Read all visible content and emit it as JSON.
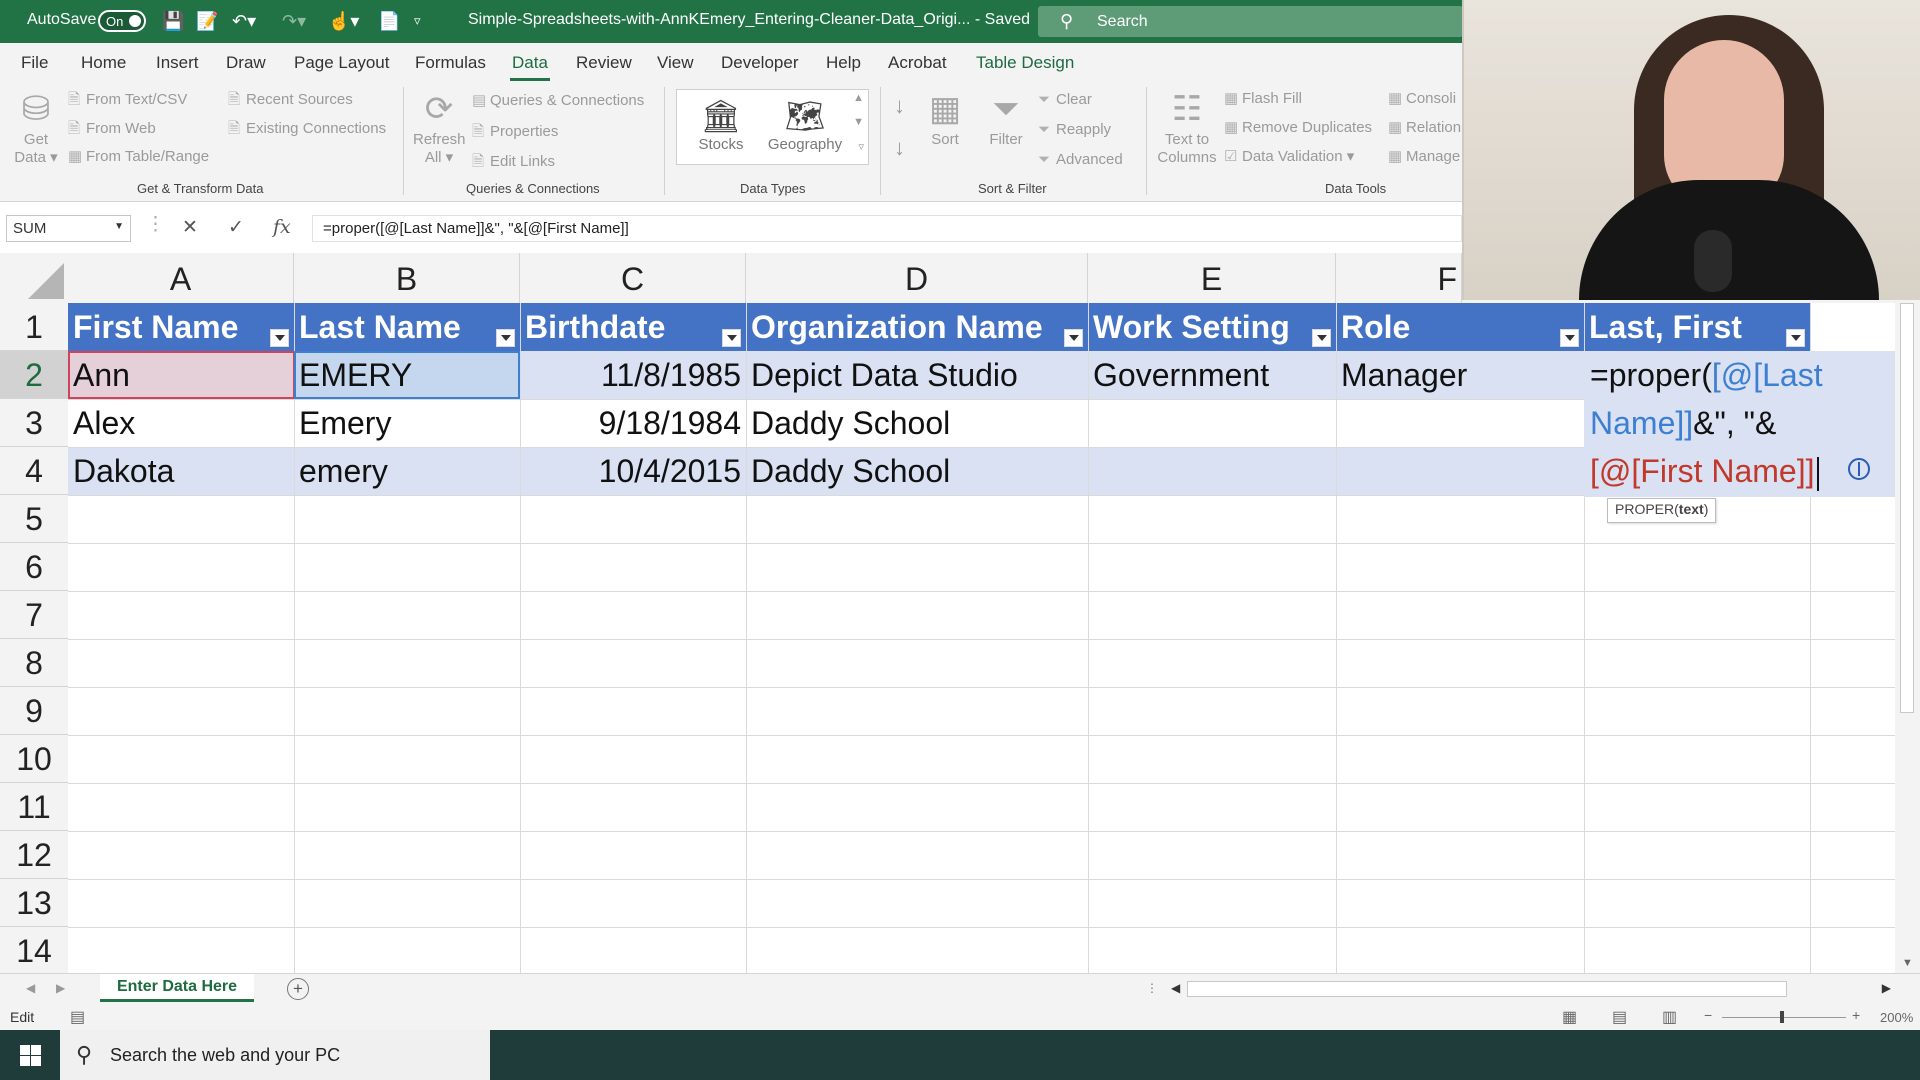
{
  "titlebar": {
    "autosave_label": "AutoSave",
    "autosave_state": "On",
    "document_title": "Simple-Spreadsheets-with-AnnKEmery_Entering-Cleaner-Data_Origi... - Saved",
    "search_placeholder": "Search"
  },
  "ribbon_tabs": [
    "File",
    "Home",
    "Insert",
    "Draw",
    "Page Layout",
    "Formulas",
    "Data",
    "Review",
    "View",
    "Developer",
    "Help",
    "Acrobat",
    "Table Design"
  ],
  "active_tab": "Data",
  "ribbon": {
    "get_data": "Get Data",
    "from_text_csv": "From Text/CSV",
    "from_web": "From Web",
    "from_table_range": "From Table/Range",
    "recent_sources": "Recent Sources",
    "existing_connections": "Existing Connections",
    "group_get_transform": "Get & Transform Data",
    "refresh_all": "Refresh All",
    "queries_connections": "Queries & Connections",
    "properties": "Properties",
    "edit_links": "Edit Links",
    "group_queries": "Queries & Connections",
    "stocks": "Stocks",
    "geography": "Geography",
    "group_data_types": "Data Types",
    "sort": "Sort",
    "filter": "Filter",
    "clear": "Clear",
    "reapply": "Reapply",
    "advanced": "Advanced",
    "group_sort_filter": "Sort & Filter",
    "text_to_columns": "Text to Columns",
    "flash_fill": "Flash Fill",
    "remove_duplicates": "Remove Duplicates",
    "data_validation": "Data Validation",
    "consolidate": "Consoli",
    "relationships": "Relation",
    "manage": "Manage",
    "group_data_tools": "Data Tools"
  },
  "formula_bar": {
    "name_box": "SUM",
    "formula": "=proper([@[Last Name]]&\", \"&[@[First Name]]"
  },
  "columns": [
    "A",
    "B",
    "C",
    "D",
    "E",
    "F"
  ],
  "rows": [
    "1",
    "2",
    "3",
    "4",
    "5",
    "6",
    "7",
    "8",
    "9",
    "10",
    "11",
    "12",
    "13",
    "14"
  ],
  "table": {
    "headers": [
      "First Name",
      "Last Name",
      "Birthdate",
      "Organization Name",
      "Work Setting",
      "Role",
      "Last, First"
    ],
    "data": [
      [
        "Ann",
        "EMERY",
        "11/8/1985",
        "Depict Data Studio",
        "Government",
        "Manager"
      ],
      [
        "Alex",
        "Emery",
        "9/18/1984",
        "Daddy School",
        "",
        ""
      ],
      [
        "Dakota",
        "emery",
        "10/4/2015",
        "Daddy School",
        "",
        ""
      ]
    ]
  },
  "edit_cell": {
    "part1": "=proper(",
    "part2": "[@[Last Name]]",
    "part3": "&\", \"&",
    "part4": "[@[First Name]]"
  },
  "tooltip": {
    "func": "PROPER(",
    "arg": "text",
    "close": ")"
  },
  "sheet": {
    "tab_name": "Enter Data Here",
    "add_symbol": "+"
  },
  "statusbar": {
    "mode": "Edit",
    "zoom": "200%"
  },
  "taskbar": {
    "search_placeholder": "Search the web and your PC"
  },
  "colors": {
    "excel_green": "#217346",
    "table_header": "#4472c4",
    "table_band": "#d9e1f2",
    "ref_last_name": "#3d7fd0",
    "ref_first_name": "#d0435a"
  }
}
